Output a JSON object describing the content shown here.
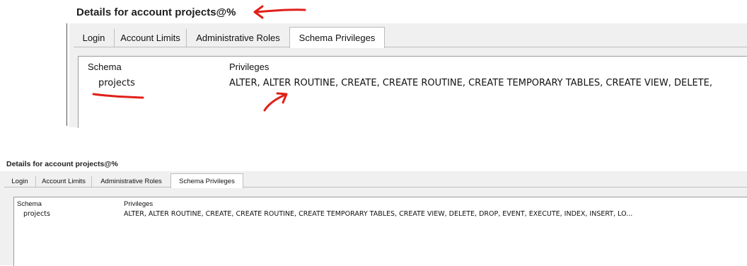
{
  "window_title": "Details for account projects@%",
  "tabs": [
    {
      "label": "Login"
    },
    {
      "label": "Account Limits"
    },
    {
      "label": "Administrative Roles"
    },
    {
      "label": "Schema Privileges"
    }
  ],
  "active_tab": "Schema Privileges",
  "columns": {
    "schema": "Schema",
    "privileges": "Privileges"
  },
  "top_row": {
    "schema": "projects",
    "privileges": "ALTER, ALTER ROUTINE, CREATE, CREATE ROUTINE, CREATE TEMPORARY TABLES, CREATE VIEW, DELETE,"
  },
  "bottom_row": {
    "schema": "projects",
    "privileges": "ALTER, ALTER ROUTINE, CREATE, CREATE ROUTINE, CREATE TEMPORARY TABLES, CREATE VIEW, DELETE, DROP, EVENT, EXECUTE, INDEX, INSERT, LO..."
  },
  "annotation_color": "#e0201a"
}
